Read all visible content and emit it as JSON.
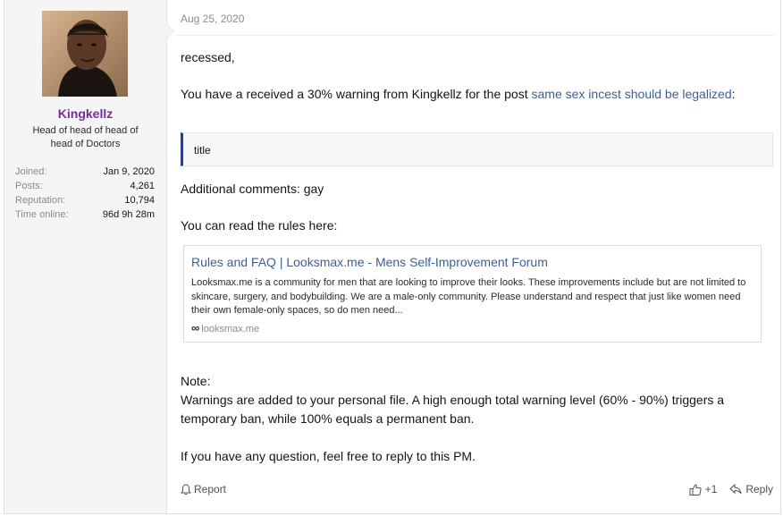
{
  "user": {
    "name": "Kingkellz",
    "title": "Head of head of head of head of Doctors",
    "stats": [
      {
        "label": "Joined:",
        "value": "Jan 9, 2020"
      },
      {
        "label": "Posts:",
        "value": "4,261"
      },
      {
        "label": "Reputation:",
        "value": "10,794"
      },
      {
        "label": "Time online:",
        "value": "96d 9h 28m"
      }
    ]
  },
  "post": {
    "date": "Aug 25, 2020",
    "greeting": "recessed,",
    "warning_prefix": "You have a received a 30% warning from Kingkellz for the post ",
    "warning_link": "same sex incest should be legalized",
    "warning_suffix": ":",
    "quote": "title",
    "comments": "Additional comments: gay",
    "rules_intro": "You can read the rules here:",
    "unfurl": {
      "title": "Rules and FAQ | Looksmax.me - Mens Self-Improvement Forum",
      "description": "Looksmax.me is a community for men that are looking to improve their looks. These improvements include but are not limited to skincare, surgery, and bodybuilding. We are a male-only community. Please understand and respect that just like women need their own female-only spaces, so do men need...",
      "domain": "looksmax.me"
    },
    "note_label": "Note:",
    "note_line1": "Warnings are added to your personal file. A high enough total warning level (60% - 90%) triggers a",
    "note_line2": "temporary ban, while 100% equals a permanent ban.",
    "closing": "If you have any question, feel free to reply to this PM."
  },
  "actions": {
    "report": "Report",
    "like_count": "+1",
    "reply": "Reply"
  }
}
